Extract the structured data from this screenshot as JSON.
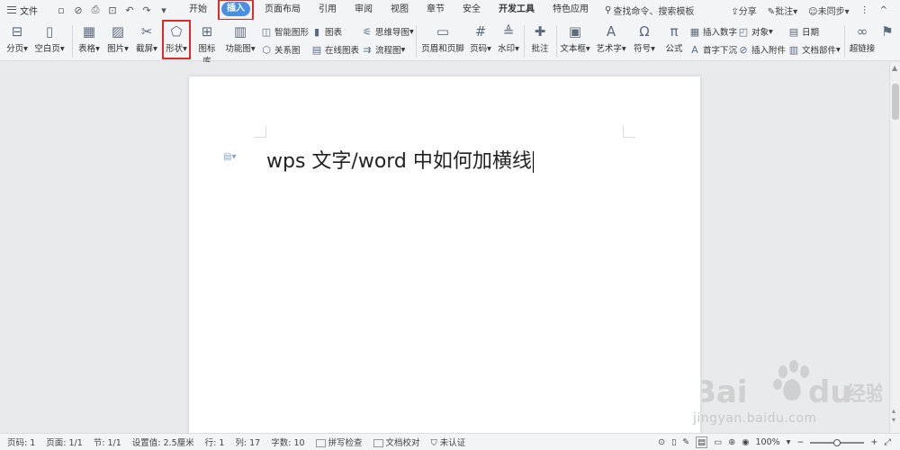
{
  "menubar": {
    "file_label": "文件",
    "tabs": [
      "开始",
      "插入",
      "页面布局",
      "引用",
      "审阅",
      "视图",
      "章节",
      "安全",
      "开发工具",
      "特色应用"
    ],
    "active_tab": "插入",
    "search_label": "查找命令、搜索模板",
    "share_label": "分享",
    "comment_label": "批注",
    "sync_label": "未同步"
  },
  "ribbon": {
    "page_break": "分页",
    "blank_page": "空白页",
    "table": "表格",
    "picture": "图片",
    "screenshot": "截屏",
    "shapes": "形状",
    "icon_lib": "图标库",
    "function_chart": "功能图",
    "smart_shape": "智能图形",
    "chart": "图表",
    "mind_map": "思维导图",
    "relation_chart": "关系图",
    "online_chart": "在线图表",
    "flowchart": "流程图",
    "header_footer": "页眉和页脚",
    "page_number": "页码",
    "watermark": "水印",
    "comment": "批注",
    "textbox": "文本框",
    "wordart": "艺术字",
    "symbol": "符号",
    "formula": "公式",
    "insert_number": "插入数字",
    "object": "对象",
    "date": "日期",
    "drop_cap": "首字下沉",
    "attachment": "插入附件",
    "doc_parts": "文档部件",
    "hyperlink": "超链接"
  },
  "document": {
    "text": "wps 文字/word 中如何加横线"
  },
  "status": {
    "page_num": "页码: 1",
    "pages": "页面: 1/1",
    "section": "节: 1/1",
    "setting": "设置值: 2.5厘米",
    "row": "行: 1",
    "col": "列: 17",
    "word_count": "字数: 10",
    "spell_check": "拼写检查",
    "proofread": "文档校对",
    "certify": "未认证",
    "zoom": "100%"
  },
  "watermark": {
    "url": "jingyan.baidu.com"
  }
}
